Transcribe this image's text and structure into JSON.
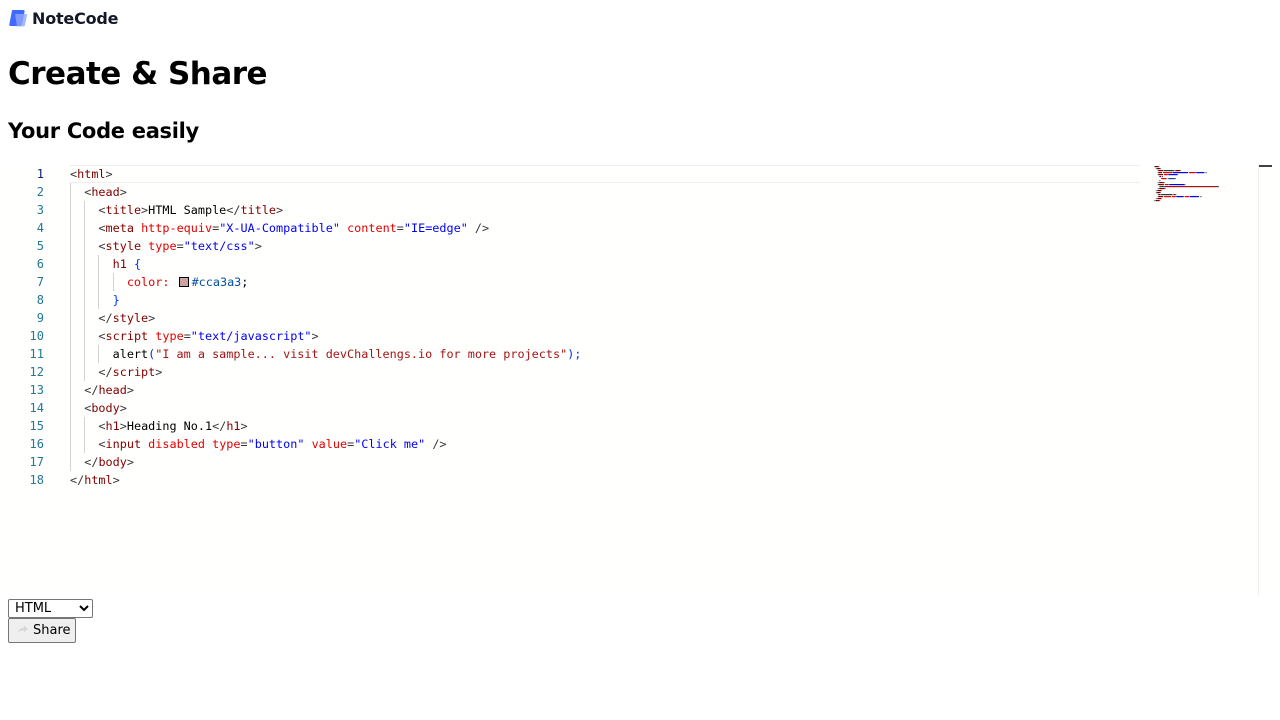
{
  "app": {
    "brand": "NoteCode",
    "title": "Create & Share",
    "subtitle": "Your Code easily",
    "accent_color": "#406AFF"
  },
  "editor": {
    "active_line": 1,
    "line_numbers": [
      "1",
      "2",
      "3",
      "4",
      "5",
      "6",
      "7",
      "8",
      "9",
      "10",
      "11",
      "12",
      "13",
      "14",
      "15",
      "16",
      "17",
      "18"
    ],
    "lines": [
      [
        [
          "t-delim",
          "<"
        ],
        [
          "t-tag",
          "html"
        ],
        [
          "t-delim",
          ">"
        ]
      ],
      [
        [
          "",
          "  "
        ],
        [
          "t-delim",
          "<"
        ],
        [
          "t-tag",
          "head"
        ],
        [
          "t-delim",
          ">"
        ]
      ],
      [
        [
          "",
          "    "
        ],
        [
          "t-delim",
          "<"
        ],
        [
          "t-tag",
          "title"
        ],
        [
          "t-delim",
          ">"
        ],
        [
          "",
          "HTML Sample"
        ],
        [
          "t-delim",
          "</"
        ],
        [
          "t-tag",
          "title"
        ],
        [
          "t-delim",
          ">"
        ]
      ],
      [
        [
          "",
          "    "
        ],
        [
          "t-delim",
          "<"
        ],
        [
          "t-tag",
          "meta"
        ],
        [
          "",
          " "
        ],
        [
          "t-attr",
          "http-equiv"
        ],
        [
          "t-delim",
          "="
        ],
        [
          "t-str",
          "\"X-UA-Compatible\""
        ],
        [
          "",
          " "
        ],
        [
          "t-attr",
          "content"
        ],
        [
          "t-delim",
          "="
        ],
        [
          "t-str",
          "\"IE=edge\""
        ],
        [
          "",
          " "
        ],
        [
          "t-delim",
          "/>"
        ]
      ],
      [
        [
          "",
          "    "
        ],
        [
          "t-delim",
          "<"
        ],
        [
          "t-tag",
          "style"
        ],
        [
          "",
          " "
        ],
        [
          "t-attr",
          "type"
        ],
        [
          "t-delim",
          "="
        ],
        [
          "t-str",
          "\"text/css\""
        ],
        [
          "t-delim",
          ">"
        ]
      ],
      [
        [
          "",
          "      "
        ],
        [
          "t-tag",
          "h1"
        ],
        [
          "",
          " "
        ],
        [
          "t-brace",
          "{"
        ]
      ],
      [
        [
          "",
          "        "
        ],
        [
          "t-attr",
          "color:"
        ],
        [
          "",
          " "
        ],
        [
          "swatch",
          "#cca3a3"
        ],
        [
          "t-hex",
          "#cca3a3"
        ],
        [
          "",
          ";"
        ]
      ],
      [
        [
          "",
          "      "
        ],
        [
          "t-brace",
          "}"
        ]
      ],
      [
        [
          "",
          "    "
        ],
        [
          "t-delim",
          "</"
        ],
        [
          "t-tag",
          "style"
        ],
        [
          "t-delim",
          ">"
        ]
      ],
      [
        [
          "",
          "    "
        ],
        [
          "t-delim",
          "<"
        ],
        [
          "t-tag",
          "script"
        ],
        [
          "",
          " "
        ],
        [
          "t-attr",
          "type"
        ],
        [
          "t-delim",
          "="
        ],
        [
          "t-str",
          "\"text/javascript\""
        ],
        [
          "t-delim",
          ">"
        ]
      ],
      [
        [
          "",
          "      "
        ],
        [
          "",
          "alert"
        ],
        [
          "t-brace",
          "("
        ],
        [
          "t-str2",
          "\"I am a sample... visit devChallengs.io for more projects\""
        ],
        [
          "t-brace",
          ")"
        ],
        [
          "t-brace",
          ";"
        ]
      ],
      [
        [
          "",
          "    "
        ],
        [
          "t-delim",
          "</"
        ],
        [
          "t-tag",
          "script"
        ],
        [
          "t-delim",
          ">"
        ]
      ],
      [
        [
          "",
          "  "
        ],
        [
          "t-delim",
          "</"
        ],
        [
          "t-tag",
          "head"
        ],
        [
          "t-delim",
          ">"
        ]
      ],
      [
        [
          "",
          "  "
        ],
        [
          "t-delim",
          "<"
        ],
        [
          "t-tag",
          "body"
        ],
        [
          "t-delim",
          ">"
        ]
      ],
      [
        [
          "",
          "    "
        ],
        [
          "t-delim",
          "<"
        ],
        [
          "t-tag",
          "h1"
        ],
        [
          "t-delim",
          ">"
        ],
        [
          "",
          "Heading No.1"
        ],
        [
          "t-delim",
          "</"
        ],
        [
          "t-tag",
          "h1"
        ],
        [
          "t-delim",
          ">"
        ]
      ],
      [
        [
          "",
          "    "
        ],
        [
          "t-delim",
          "<"
        ],
        [
          "t-tag",
          "input"
        ],
        [
          "",
          " "
        ],
        [
          "t-attr",
          "disabled"
        ],
        [
          "",
          " "
        ],
        [
          "t-attr",
          "type"
        ],
        [
          "t-delim",
          "="
        ],
        [
          "t-str",
          "\"button\""
        ],
        [
          "",
          " "
        ],
        [
          "t-attr",
          "value"
        ],
        [
          "t-delim",
          "="
        ],
        [
          "t-str",
          "\"Click me\""
        ],
        [
          "",
          " "
        ],
        [
          "t-delim",
          "/>"
        ]
      ],
      [
        [
          "",
          "  "
        ],
        [
          "t-delim",
          "</"
        ],
        [
          "t-tag",
          "body"
        ],
        [
          "t-delim",
          ">"
        ]
      ],
      [
        [
          "t-delim",
          "</"
        ],
        [
          "t-tag",
          "html"
        ],
        [
          "t-delim",
          ">"
        ]
      ]
    ],
    "minimap_icon": "code-minimap"
  },
  "controls": {
    "language_selected": "HTML",
    "language_options": [
      "HTML"
    ],
    "share_label": "Share",
    "share_icon": "share-icon"
  }
}
